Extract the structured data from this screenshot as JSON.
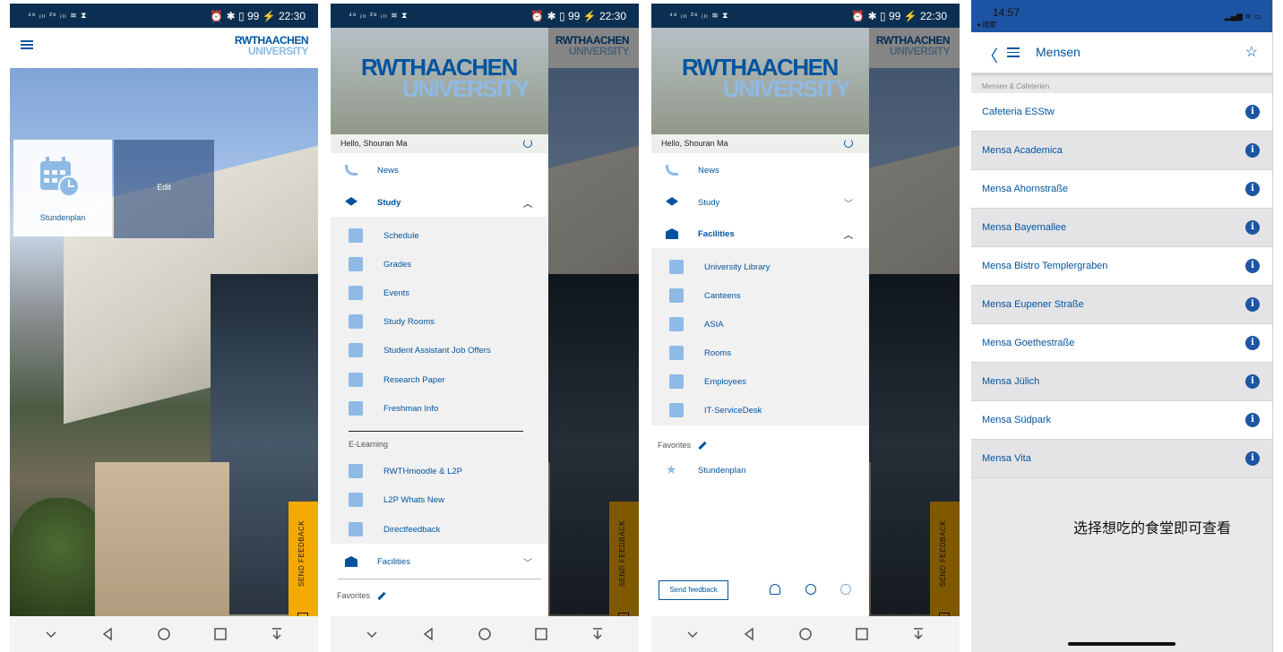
{
  "status_bar": {
    "signal": "⁴⁶ ᵢₗₗ ²⁶ ᵢₗₗ ≋ ⧗",
    "icons": "⏰ ✱ ▯ 99 ⚡",
    "time": "22:30"
  },
  "brand": {
    "line1": "RWTHAACHEN",
    "line2": "UNIVERSITY",
    "color": "#00549f",
    "light": "#8ebae5"
  },
  "home": {
    "widget_label": "Stundenplan",
    "edit_label": "Edit",
    "feedback_tab": "SEND FEEDBACK"
  },
  "drawer": {
    "greeting": "Hello, Shouran Ma",
    "news": "News",
    "study": "Study",
    "facilities": "Facilities",
    "study_items": [
      "Schedule",
      "Grades",
      "Events",
      "Study Rooms",
      "Student Assistant Job Offers",
      "Research Paper",
      "Freshman Info"
    ],
    "elearning_label": "E-Learning",
    "elearning_items": [
      "RWTHmoodle & L2P",
      "L2P Whats New",
      "Directfeedback"
    ],
    "favorites_label": "Favorites"
  },
  "drawer2": {
    "facility_items": [
      "University Library",
      "Canteens",
      "ASIA",
      "Rooms",
      "Employees",
      "IT-ServiceDesk"
    ],
    "favorite_items": [
      "Stundenplan"
    ],
    "send_feedback": "Send feedback"
  },
  "ios": {
    "time": "14:57",
    "back_app": "◂ 搜索",
    "title": "Mensen",
    "section": "Mensen & Cafeterien",
    "canteens": [
      "Cafeteria ESStw",
      "Mensa Academica",
      "Mensa Ahornstraße",
      "Mensa Bayernallee",
      "Mensa Bistro Templergraben",
      "Mensa Eupener Straße",
      "Mensa Goethestraße",
      "Mensa Jülich",
      "Mensa Südpark",
      "Mensa Vita"
    ],
    "caption": "选择想吃的食堂即可查看"
  }
}
